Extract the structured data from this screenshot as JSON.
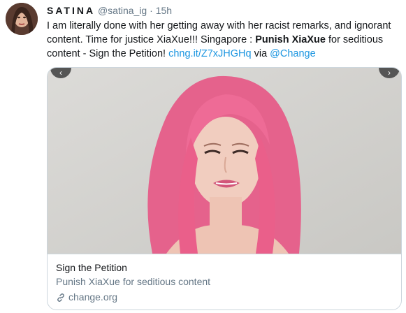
{
  "tweet": {
    "display_name": "SATINA",
    "handle": "@satina_ig",
    "separator": "·",
    "time": "15h",
    "text_part1": "I am literally done with her getting away with her racist remarks, and ignorant content. Time for justice XiaXue!!! Singapore : ",
    "text_bold": "Punish XiaXue",
    "text_part2": " for seditious content - Sign the Petition! ",
    "link_text": "chng.it/Z7xJHGHq",
    "via_text": " via ",
    "mention": "@Change"
  },
  "card": {
    "title": "Sign the Petition",
    "description": "Punish XiaXue for seditious content",
    "domain": "change.org",
    "domain_icon": "link-icon"
  },
  "colors": {
    "link": "#1b95e0",
    "secondary": "#657786",
    "border": "#ccd6dd",
    "hair": "#e8678f"
  }
}
